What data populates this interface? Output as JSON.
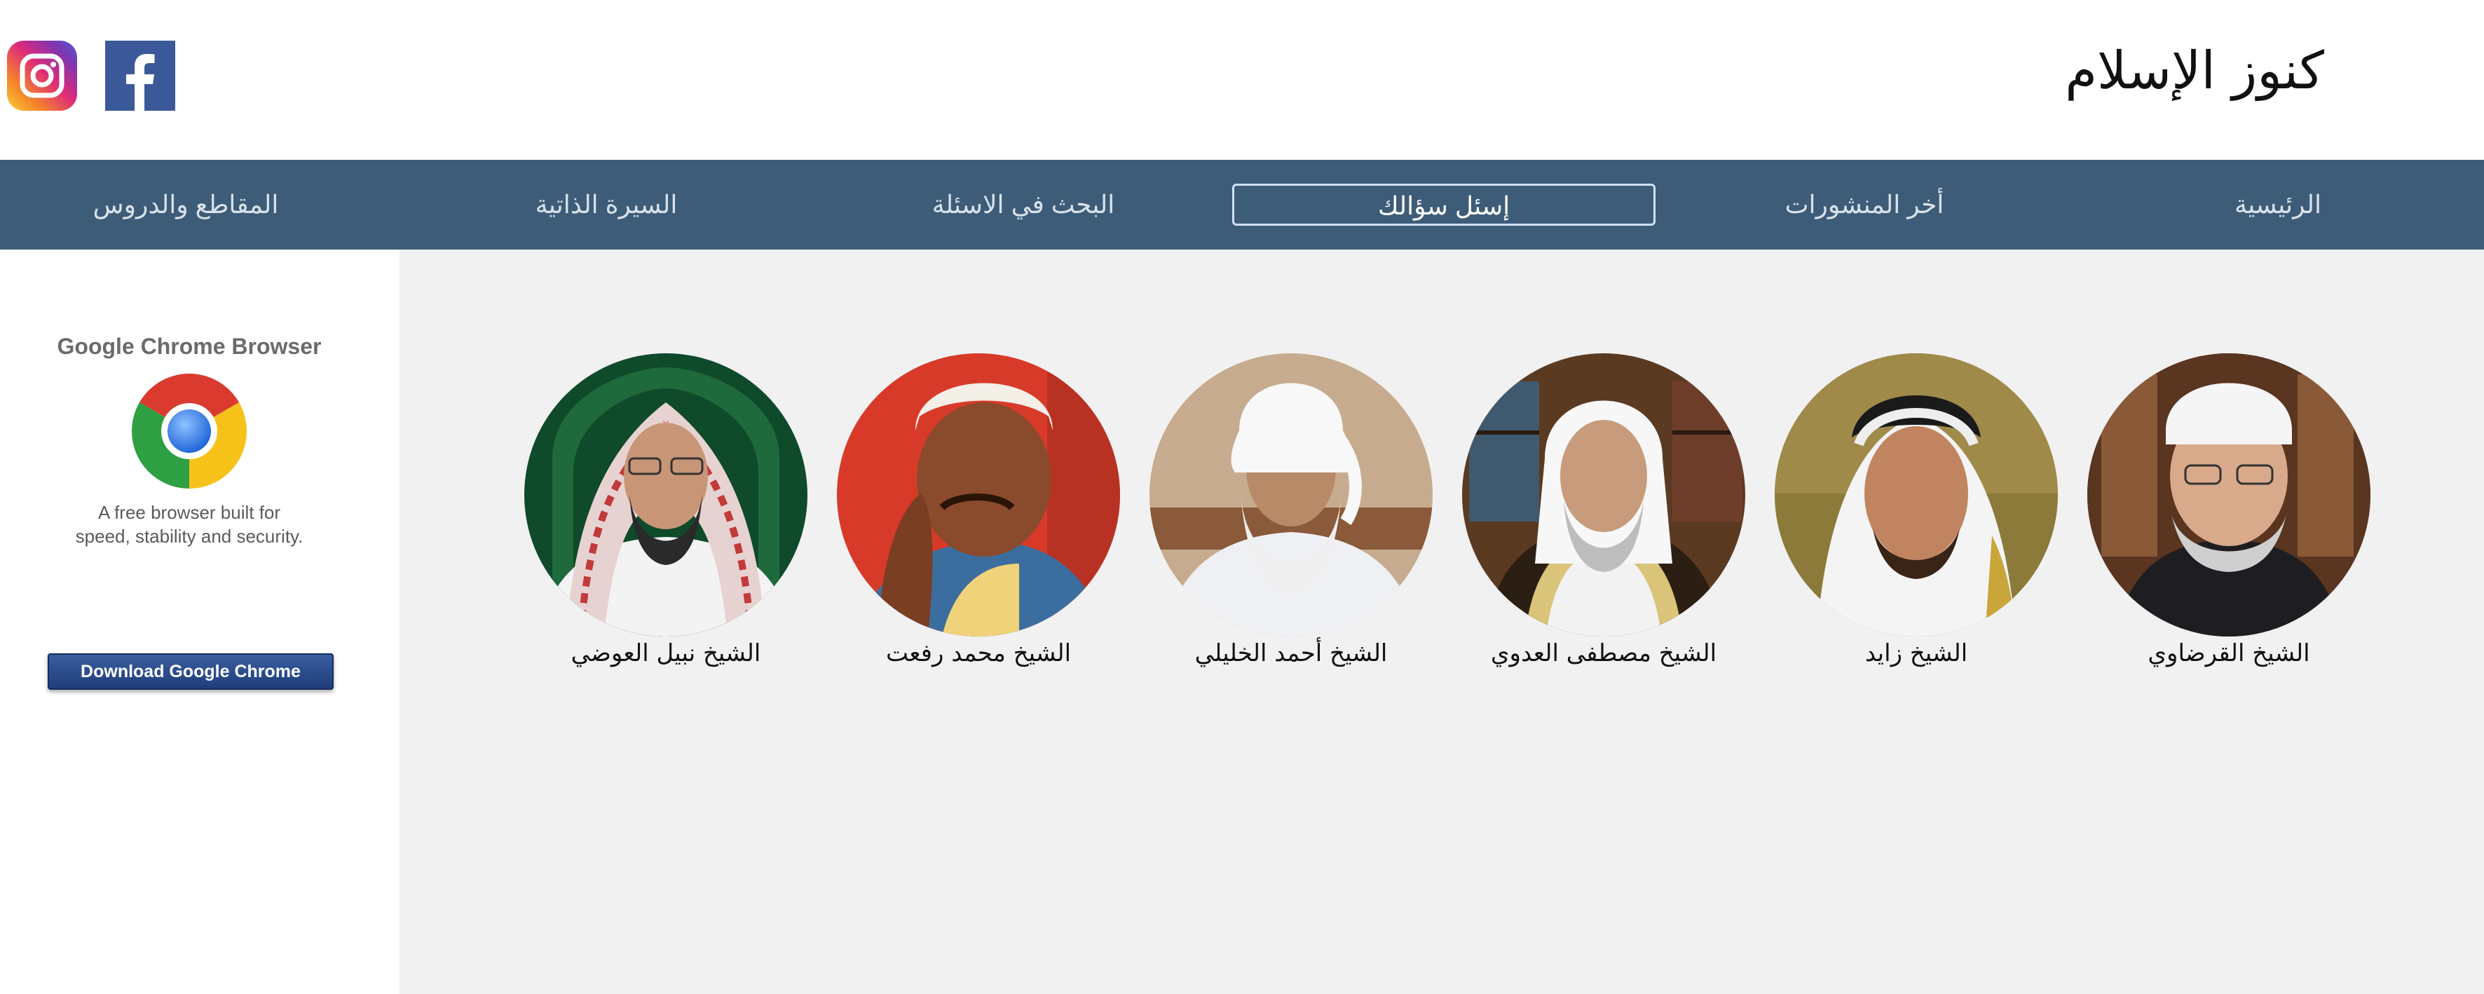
{
  "header": {
    "site_title": "كنوز الإسلام",
    "social": [
      {
        "name": "instagram-icon"
      },
      {
        "name": "facebook-icon"
      }
    ]
  },
  "nav": {
    "items": [
      {
        "label": "الرئيسية",
        "active": false
      },
      {
        "label": "أخر المنشورات",
        "active": false
      },
      {
        "label": "إسئل سؤالك",
        "active": true
      },
      {
        "label": "البحث في الاسئلة",
        "active": false
      },
      {
        "label": "السيرة الذاتية",
        "active": false
      },
      {
        "label": "المقاطع والدروس",
        "active": false
      }
    ]
  },
  "sidebar": {
    "ad": {
      "title": "Google Chrome Browser",
      "text": "A free browser built for\nspeed, stability and security.",
      "button_label": "Download Google Chrome"
    }
  },
  "main": {
    "scholars": [
      {
        "name": "الشيخ القرضاوي"
      },
      {
        "name": "الشيخ زايد"
      },
      {
        "name": "الشيخ مصطفى العدوي"
      },
      {
        "name": "الشيخ أحمد الخليلي"
      },
      {
        "name": "الشيخ محمد رفعت"
      },
      {
        "name": "الشيخ نبيل العوضي"
      }
    ]
  },
  "colors": {
    "nav_bg": "#3d5c78",
    "nav_text": "#d8e2ea",
    "main_bg": "#f1f1f1",
    "facebook": "#3b5998"
  }
}
